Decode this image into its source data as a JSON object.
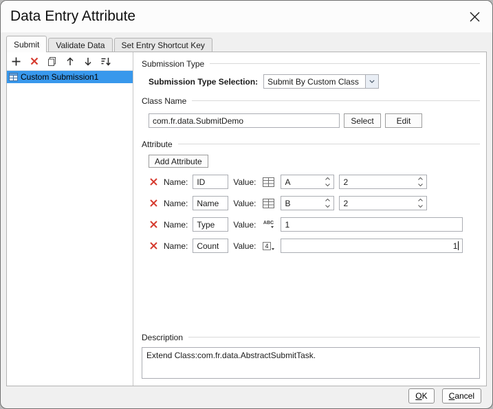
{
  "window": {
    "title": "Data Entry Attribute"
  },
  "colors": {
    "selection": "#3898ec",
    "delete_red": "#d63b2f",
    "panel_border": "#b3b3b3"
  },
  "tabs": [
    {
      "label": "Submit",
      "active": true
    },
    {
      "label": "Validate Data",
      "active": false
    },
    {
      "label": "Set Entry Shortcut Key",
      "active": false
    }
  ],
  "left_panel": {
    "toolbar_icons": [
      "add-icon",
      "delete-icon",
      "copy-icon",
      "move-up-icon",
      "move-down-icon",
      "sort-icon"
    ],
    "items": [
      {
        "label": "Custom Submission1",
        "selected": true
      }
    ]
  },
  "right_panel": {
    "submission_type": {
      "group_label": "Submission Type",
      "selection_label": "Submission Type Selection:",
      "selected_value": "Submit By Custom Class"
    },
    "class_name": {
      "group_label": "Class Name",
      "value": "com.fr.data.SubmitDemo",
      "select_button": "Select",
      "edit_button": "Edit"
    },
    "attribute": {
      "group_label": "Attribute",
      "add_button": "Add Attribute",
      "name_label": "Name:",
      "value_label": "Value:",
      "rows": [
        {
          "name": "ID",
          "value_type": "column",
          "value": "A",
          "count": "2"
        },
        {
          "name": "Name",
          "value_type": "column",
          "value": "B",
          "count": "2"
        },
        {
          "name": "Type",
          "value_type": "string",
          "value": "1"
        },
        {
          "name": "Count",
          "value_type": "number",
          "value": "1"
        }
      ]
    },
    "description": {
      "group_label": "Description",
      "text": "Extend Class:com.fr.data.AbstractSubmitTask."
    }
  },
  "footer": {
    "ok_label": "OK",
    "cancel_label": "Cancel"
  }
}
